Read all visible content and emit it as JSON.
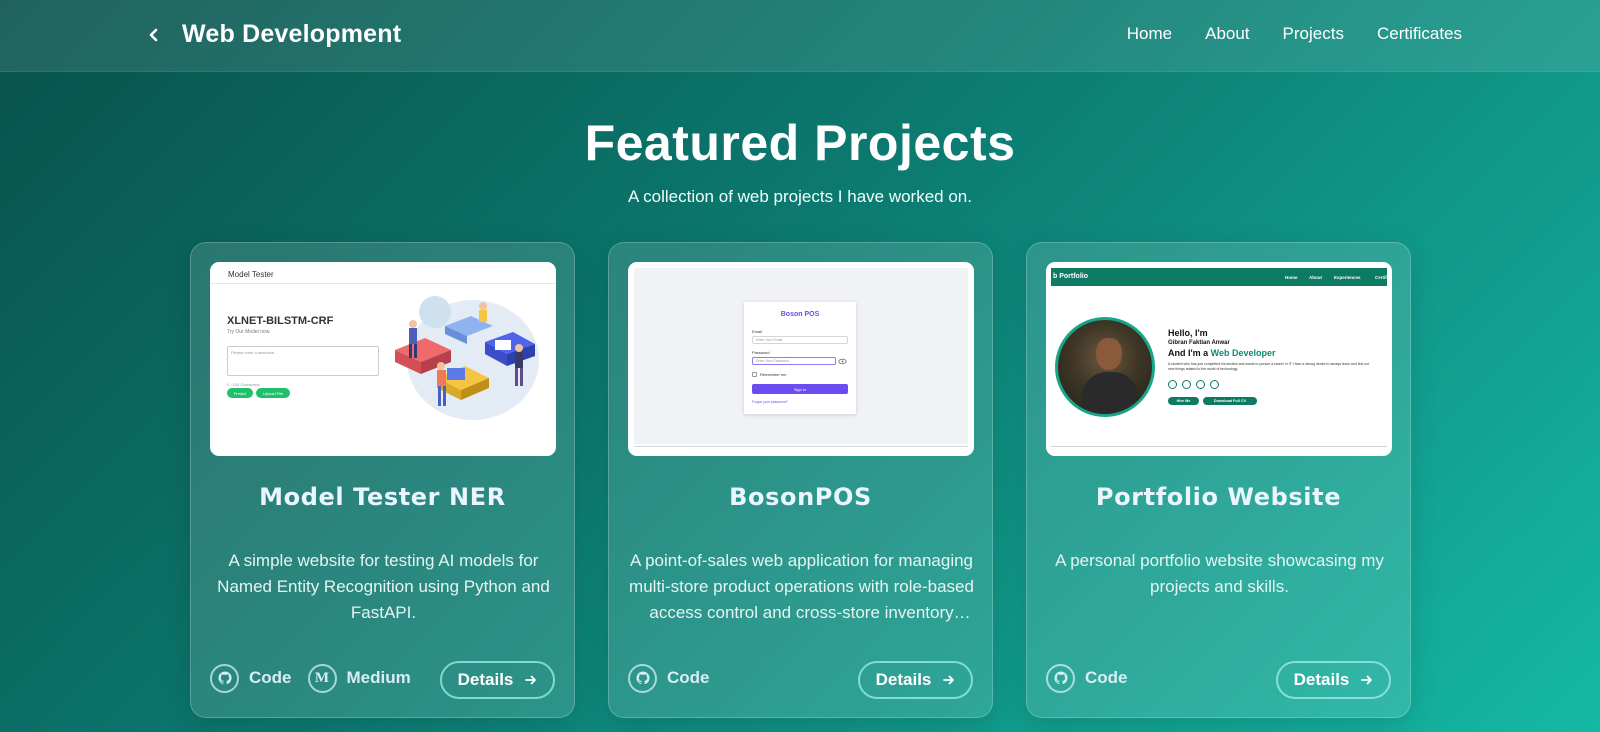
{
  "header": {
    "back_icon": "chevron-left-icon",
    "title": "Web Development",
    "nav": [
      "Home",
      "About",
      "Projects",
      "Certificates"
    ]
  },
  "hero": {
    "title": "Featured Projects",
    "subtitle": "A collection of web projects I have worked on."
  },
  "projects": [
    {
      "title": "Model Tester NER",
      "description": "A simple website for testing AI models for Named Entity Recognition using Python and FastAPI.",
      "links": [
        {
          "icon": "github-icon",
          "label": "Code"
        },
        {
          "icon": "medium-icon",
          "label": "Medium"
        }
      ],
      "details_label": "Details",
      "thumbnail": {
        "header": "Model Tester",
        "model_name": "XLNET-BILSTM-CRF",
        "subtitle": "Try Our Model now.",
        "placeholder": "Please enter a sentence...",
        "chars": "0 / 100 Characters",
        "buttons": [
          "Predict",
          "Upload File"
        ]
      }
    },
    {
      "title": "BosonPOS",
      "description": "A point-of-sales web application for managing multi-store product operations with role-based access control and cross-store inventory management.",
      "links": [
        {
          "icon": "github-icon",
          "label": "Code"
        }
      ],
      "details_label": "Details",
      "thumbnail": {
        "brand": "Boson POS",
        "email_label": "Email",
        "email_placeholder": "Enter Your Email",
        "password_label": "Password",
        "password_placeholder": "Enter Your Password",
        "remember": "Remember me",
        "signin": "Sign in",
        "forgot": "Forgot your password?"
      }
    },
    {
      "title": "Portfolio Website",
      "description": "A personal portfolio website showcasing my projects and skills.",
      "links": [
        {
          "icon": "github-icon",
          "label": "Code"
        }
      ],
      "details_label": "Details",
      "thumbnail": {
        "logo": "b Portfolio",
        "nav": [
          "Home",
          "About",
          "Experiences",
          "Certif"
        ],
        "hello": "Hello, I'm",
        "name": "Gibran Faktian Anwar",
        "role_prefix": "And I'm a ",
        "role": "Web Developer",
        "about": "A student who has just completed his studies and wants to pursue a career in IT. Have a strong desire to always learn and find out new things related to the world of technology.",
        "buttons": [
          "Hire Me",
          "Download Full CV"
        ]
      }
    }
  ],
  "colors": {
    "bg_start": "#08514c",
    "bg_end": "#15b8a4",
    "accent_purple": "#6a4cf0",
    "accent_green": "#1fbf6c",
    "portfolio_teal": "#0d7a63"
  }
}
